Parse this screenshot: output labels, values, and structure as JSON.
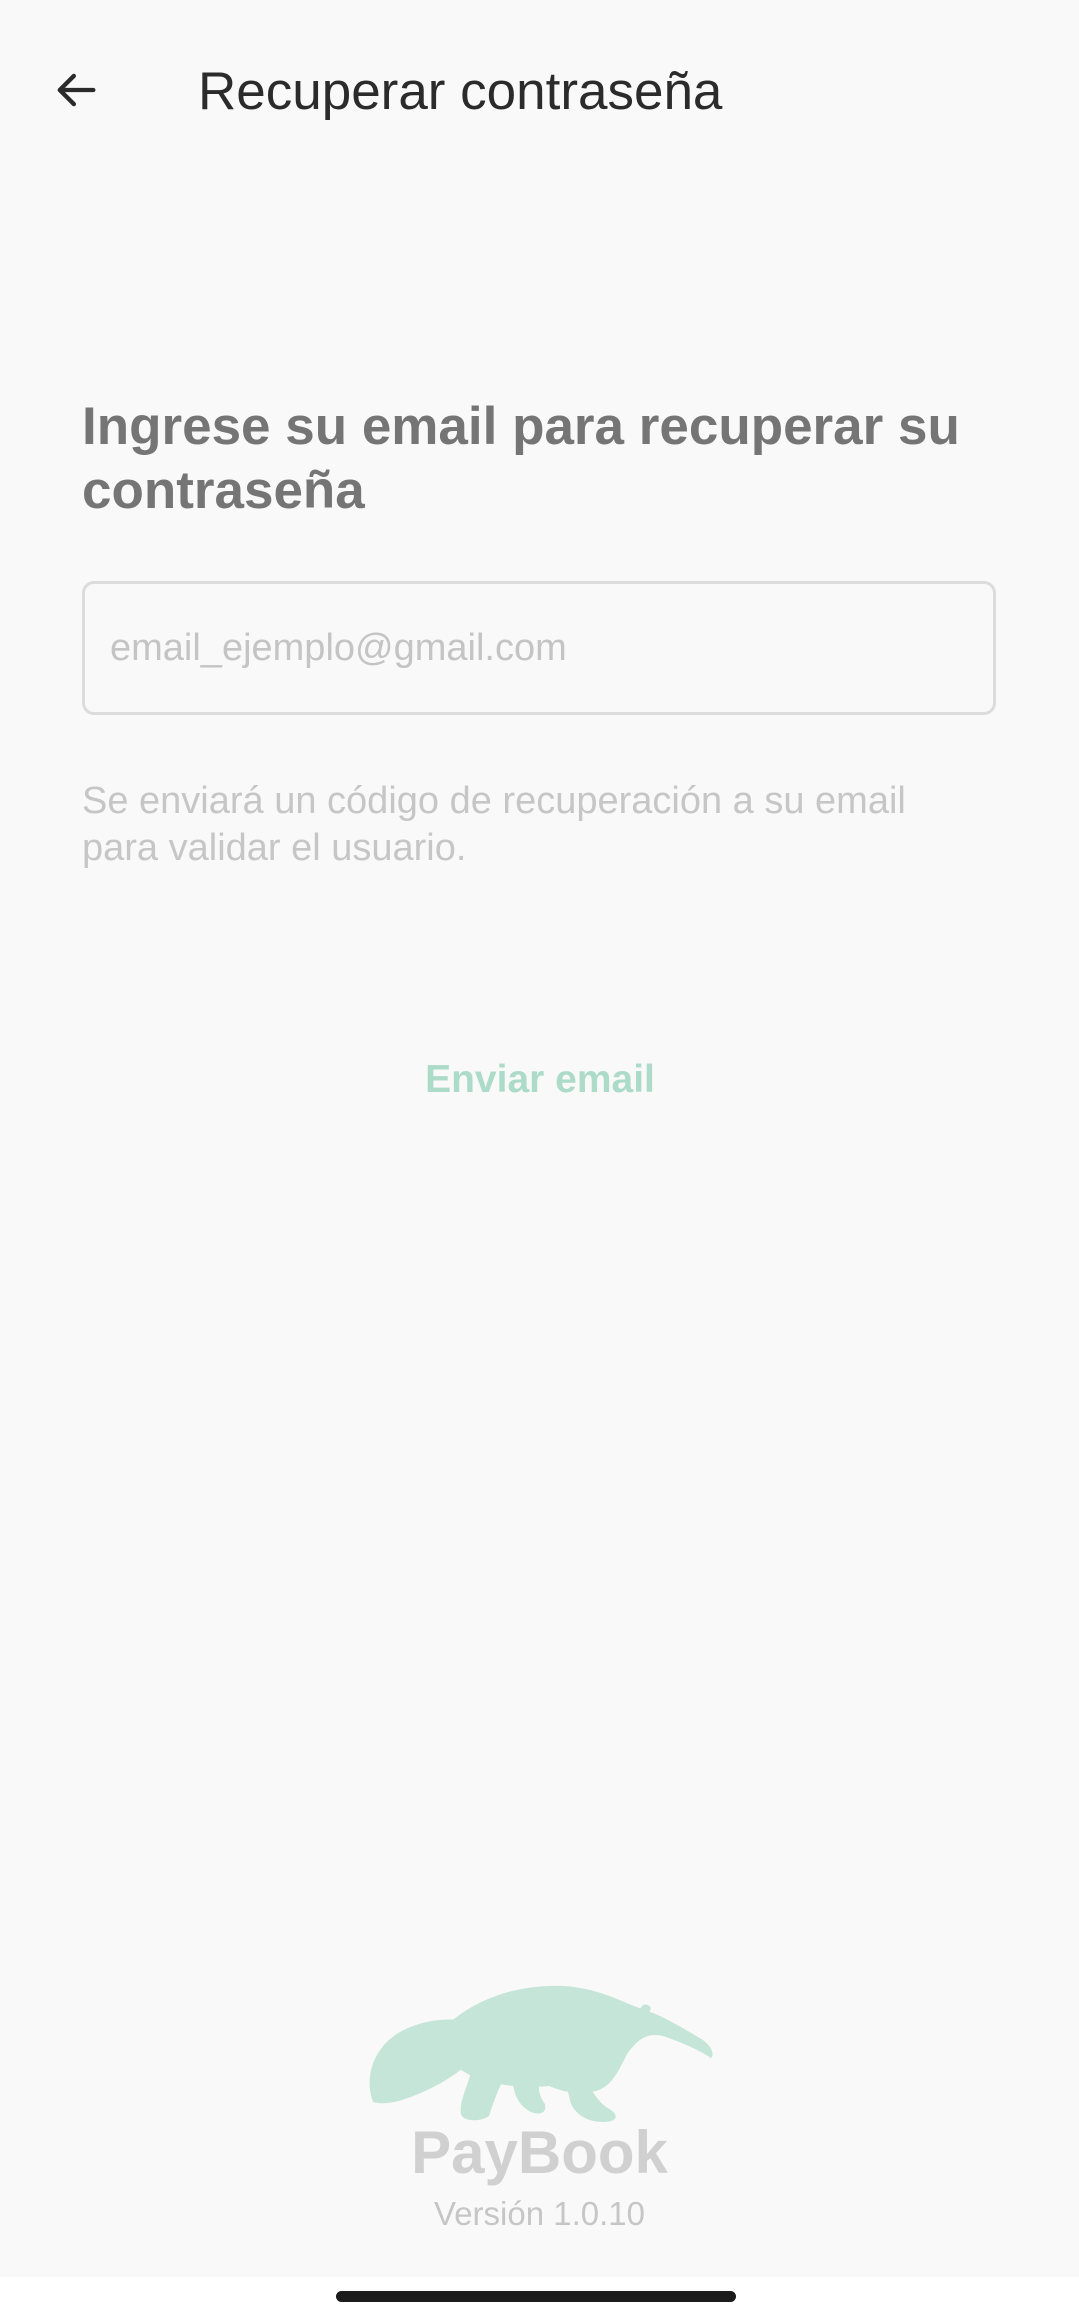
{
  "app_bar": {
    "title": "Recuperar contraseña",
    "back_icon": "arrow-left-icon"
  },
  "form": {
    "heading": "Ingrese su email para recuperar su contraseña",
    "email_placeholder": "email_ejemplo@gmail.com",
    "email_value": "",
    "helper_text": "Se enviará un código de recuperación a su email para validar el usuario.",
    "submit_label": "Enviar email"
  },
  "footer": {
    "logo_icon": "anteater-logo-icon",
    "brand": "PayBook",
    "version": "Versión 1.0.10"
  },
  "colors": {
    "background": "#f9f9f9",
    "accent_disabled": "#acdcc9",
    "logo": "#c5e5d9",
    "title_text": "#2b2b2b",
    "heading_text": "#757575"
  }
}
